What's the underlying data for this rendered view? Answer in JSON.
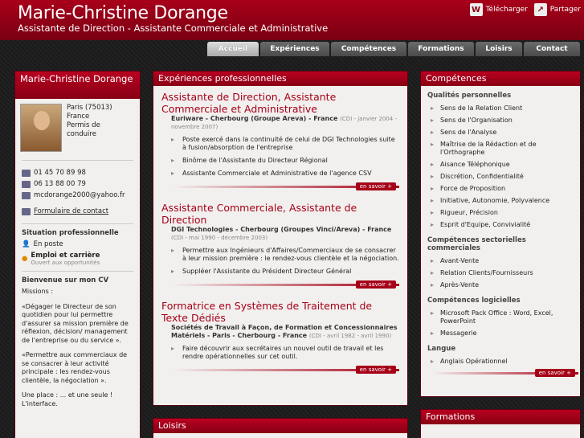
{
  "header": {
    "name": "Marie-Christine Dorange",
    "subtitle": "Assistante de Direction - Assistante Commerciale et Administrative",
    "download_label": "Télécharger",
    "share_label": "Partager"
  },
  "nav": [
    "Accueil",
    "Expériences",
    "Compétences",
    "Formations",
    "Loisirs",
    "Contact"
  ],
  "profile": {
    "name": "Marie-Christine Dorange",
    "location": [
      "Paris (75013)",
      "France",
      "Permis de",
      "conduire"
    ],
    "phone1": "01 45 70 89 98",
    "phone2": "06 13 88 00 79",
    "email": "mcdorange2000@yahoo.fr",
    "contact_form": "Formulaire de contact",
    "situation_title": "Situation professionnelle",
    "situation_status": "En poste",
    "job_title": "Emploi et carrière",
    "job_status": "Ouvert aux opportunités",
    "welcome_title": "Bienvenue sur mon CV",
    "missions_label": "Missions :",
    "cv_p1": "«Dégager le Directeur de son quotidien pour lui permettre d'assurer sa mission première de réflexion, décision/ management de l'entreprise ou du service ».",
    "cv_p2": "«Permettre aux commerciaux de se consacrer à leur activité principale : les rendez-vous clientèle, la négociation ».",
    "cv_p3": "Une place : ... et une seule ! L'interface."
  },
  "experiences": {
    "heading": "Expériences professionnelles",
    "items": [
      {
        "title": "Assistante de Direction, Assistante Commerciale et Administrative",
        "company": "Euriware - Cherbourg (Groupe Areva) - France",
        "date": "(CDI - janvier 2004 - novembre 2007)",
        "bullets": [
          "Poste exercé dans la continuité de celui de DGI Technologies suite à fusion/absorption de l'entreprise",
          "Binôme de l'Assistante du Directeur Régional",
          "Assistante Commerciale et Administrative de l'agence CSV"
        ]
      },
      {
        "title": "Assistante Commerciale, Assistante de Direction",
        "company": "DGI Technologies - Cherbourg (Groupes Vinci/Areva) - France",
        "date": "(CDI - mai 1990 - décembre 2003)",
        "bullets": [
          "Permettre aux Ingénieurs d'Affaires/Commerciaux de se consacrer à leur mission première : le rendez-vous clientèle et la négociation.",
          "Suppléer l'Assistante du Président Directeur Général"
        ]
      },
      {
        "title": "Formatrice en Systèmes de Traitement de Texte Dédiés",
        "company": "Sociétés de Travail à Façon, de Formation et Concessionnaires Matériels - Paris - Cherbourg - France",
        "date": "(CDI - avril 1982 - avril 1990)",
        "bullets": [
          "Faire découvrir aux secrétaires un nouvel outil de travail et les rendre opérationnelles sur cet outil."
        ]
      }
    ],
    "more_label": "en savoir +"
  },
  "loisirs": {
    "heading": "Loisirs"
  },
  "competences": {
    "heading": "Compétences",
    "groups": [
      {
        "title": "Qualités personnelles",
        "items": [
          "Sens de la Relation Client",
          "Sens de l'Organisation",
          "Sens de l'Analyse",
          "Maîtrise de la Rédaction et de l'Orthographe",
          "Aisance Téléphonique",
          "Discrétion, Confidentialité",
          "Force de Proposition",
          "Initiative, Autonomie, Polyvalence",
          "Rigueur, Précision",
          "Esprit d'Equipe, Convivialité"
        ]
      },
      {
        "title": "Compétences sectorielles commerciales",
        "items": [
          "Avant-Vente",
          "Relation Clients/Fournisseurs",
          "Après-Vente"
        ]
      },
      {
        "title": "Compétences logicielles",
        "items": [
          "Microsoft Pack Office : Word, Excel, PowerPoint",
          "Messagerie"
        ]
      },
      {
        "title": "Langue",
        "items": [
          "Anglais Opérationnel"
        ]
      }
    ],
    "more_label": "en savoir +"
  },
  "formations": {
    "heading": "Formations"
  }
}
